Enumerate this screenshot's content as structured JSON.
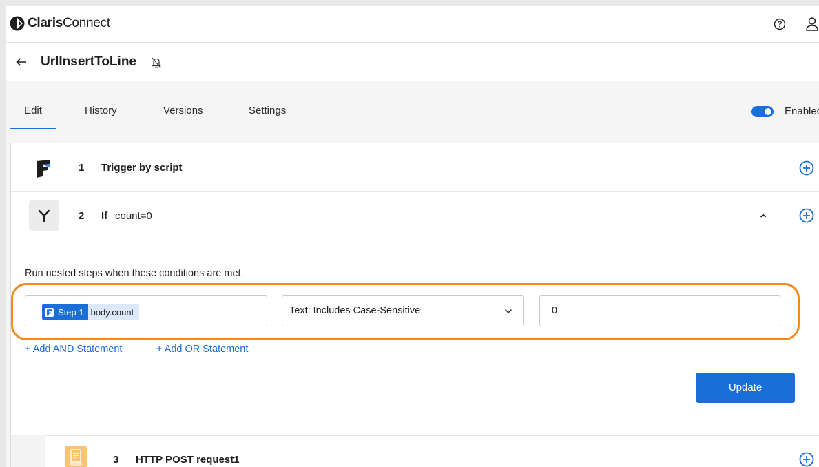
{
  "app": {
    "brand_bold": "Claris",
    "brand_light": "Connect"
  },
  "header": {
    "help_icon": "help-circle-icon",
    "user_icon": "user-icon"
  },
  "flow": {
    "title": "UrlInsertToLine",
    "back_icon": "arrow-left-icon",
    "notify_icon": "bell-off-icon"
  },
  "tabs": [
    {
      "label": "Edit",
      "active": true
    },
    {
      "label": "History",
      "active": false
    },
    {
      "label": "Versions",
      "active": false
    },
    {
      "label": "Settings",
      "active": false
    }
  ],
  "toggle": {
    "label": "Enabled",
    "on": true
  },
  "steps": [
    {
      "number": "1",
      "title": "Trigger by script",
      "icon": "filemaker-icon"
    },
    {
      "number": "2",
      "title": "If",
      "condition": "count=0",
      "icon": "branch-icon",
      "expanded": true
    },
    {
      "number": "3",
      "title": "HTTP POST request1",
      "icon": "http-icon"
    }
  ],
  "if_editor": {
    "intro": "Run nested steps when these conditions are met.",
    "left_operand": {
      "step_label": "Step 1",
      "field": "body.count"
    },
    "operator": "Text: Includes Case-Sensitive",
    "right_operand": "0",
    "add_and": "+ Add AND Statement",
    "add_or": "+ Add OR Statement",
    "update_label": "Update"
  },
  "colors": {
    "accent": "#1a6ed8",
    "highlight_ring": "#f28a1e"
  }
}
